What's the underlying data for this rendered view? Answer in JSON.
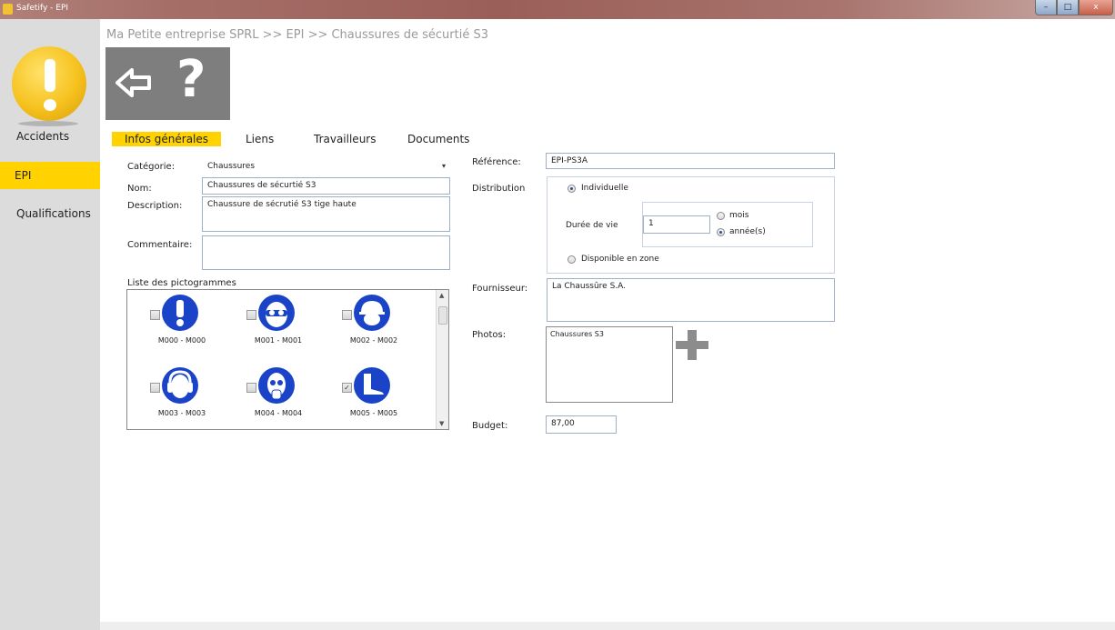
{
  "window": {
    "title": "Safetify - EPI",
    "min": "–",
    "max": "□",
    "close": "x"
  },
  "sidebar": {
    "items": [
      {
        "label": "Accidents"
      },
      {
        "label": "EPI"
      },
      {
        "label": "Qualifications"
      }
    ],
    "active": "EPI"
  },
  "breadcrumb": "Ma Petite entreprise SPRL >> EPI >> Chaussures de sécurtié S3",
  "toolbar": {
    "back_icon": "back-arrow-icon",
    "help_symbol": "?"
  },
  "tabs": [
    "Infos générales",
    "Liens",
    "Travailleurs",
    "Documents"
  ],
  "form": {
    "categorie_label": "Catégorie:",
    "categorie_value": "Chaussures",
    "nom_label": "Nom:",
    "nom_value": "Chaussures de sécurtié S3",
    "description_label": "Description:",
    "description_value": "Chaussure de sécrutié S3 tige haute",
    "commentaire_label": "Commentaire:",
    "commentaire_value": "",
    "pictos_label": "Liste des pictogrammes",
    "pictos": [
      {
        "code": "M000 - M000",
        "checked": false,
        "icon": "exclamation-icon"
      },
      {
        "code": "M001 - M001",
        "checked": false,
        "icon": "goggles-icon"
      },
      {
        "code": "M002 - M002",
        "checked": false,
        "icon": "helmet-icon"
      },
      {
        "code": "M003 - M003",
        "checked": false,
        "icon": "ear-protection-icon"
      },
      {
        "code": "M004 - M004",
        "checked": false,
        "icon": "respirator-icon"
      },
      {
        "code": "M005 - M005",
        "checked": true,
        "icon": "safety-boot-icon"
      }
    ],
    "reference_label": "Référence:",
    "reference_value": "EPI-PS3A",
    "distribution_label": "Distribution",
    "individuelle_label": "Individuelle",
    "duree_label": "Durée de vie",
    "duree_value": "1",
    "mois_label": "mois",
    "annees_label": "année(s)",
    "disponible_label": "Disponible en zone",
    "fournisseur_label": "Fournisseur:",
    "fournisseur_value": "La Chaussûre S.A.",
    "photos_label": "Photos:",
    "photos_value": "Chaussures S3",
    "budget_label": "Budget:",
    "budget_value": "87,00"
  },
  "colors": {
    "accent": "#ffd200",
    "sidebar": "#dcdcdc",
    "picto_blue": "#1a43c8",
    "toolbar": "#7e7e7e"
  }
}
